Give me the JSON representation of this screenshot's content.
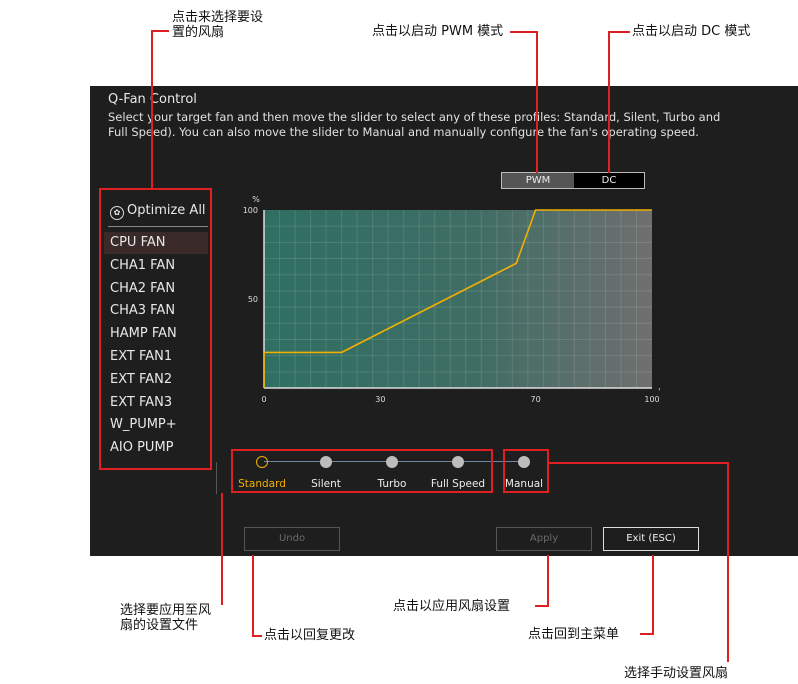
{
  "annotations": {
    "select_fan_line1": "点击来选择要设",
    "select_fan_line2": "置的风扇",
    "pwm_mode": "点击以启动 PWM 模式",
    "dc_mode": "点击以启动 DC 模式",
    "apply_profile_line1": "选择要应用至风",
    "apply_profile_line2": "扇的设置文件",
    "undo": "点击以回复更改",
    "apply": "点击以应用风扇设置",
    "exit": "点击回到主菜单",
    "manual": "选择手动设置风扇"
  },
  "window": {
    "title": "Q-Fan Control",
    "desc_line1": "Select your target fan and then move the slider to select any of these profiles: Standard, Silent, Turbo and",
    "desc_line2": "Full Speed). You can also move the slider to Manual and manually configure the fan's operating speed."
  },
  "sidebar": {
    "optimize_label": "Optimize All",
    "items": [
      {
        "label": "CPU FAN"
      },
      {
        "label": "CHA1 FAN"
      },
      {
        "label": "CHA2 FAN"
      },
      {
        "label": "CHA3 FAN"
      },
      {
        "label": "HAMP FAN"
      },
      {
        "label": "EXT FAN1"
      },
      {
        "label": "EXT FAN2"
      },
      {
        "label": "EXT FAN3"
      },
      {
        "label": "W_PUMP+"
      },
      {
        "label": "AIO PUMP"
      }
    ],
    "selected": "CPU FAN"
  },
  "mode": {
    "pwm_label": "PWM",
    "dc_label": "DC",
    "active": "PWM"
  },
  "chart_data": {
    "type": "line",
    "ylabel": "%",
    "xlabel": "°C",
    "xlim": [
      0,
      100
    ],
    "ylim": [
      0,
      100
    ],
    "x_ticks": [
      "0",
      "30",
      "70",
      "100"
    ],
    "y_ticks": [
      "100",
      "50"
    ],
    "series": [
      {
        "x": [
          0,
          0,
          20,
          65,
          70,
          100
        ],
        "y": [
          0,
          20,
          20,
          70,
          100,
          100
        ]
      }
    ],
    "line_color": "#f0b000"
  },
  "profiles": {
    "items": [
      "Standard",
      "Silent",
      "Turbo",
      "Full Speed",
      "Manual"
    ],
    "selected": "Standard",
    "selected_color": "#f0b000"
  },
  "buttons": {
    "undo": "Undo",
    "apply": "Apply",
    "exit": "Exit (ESC)"
  }
}
